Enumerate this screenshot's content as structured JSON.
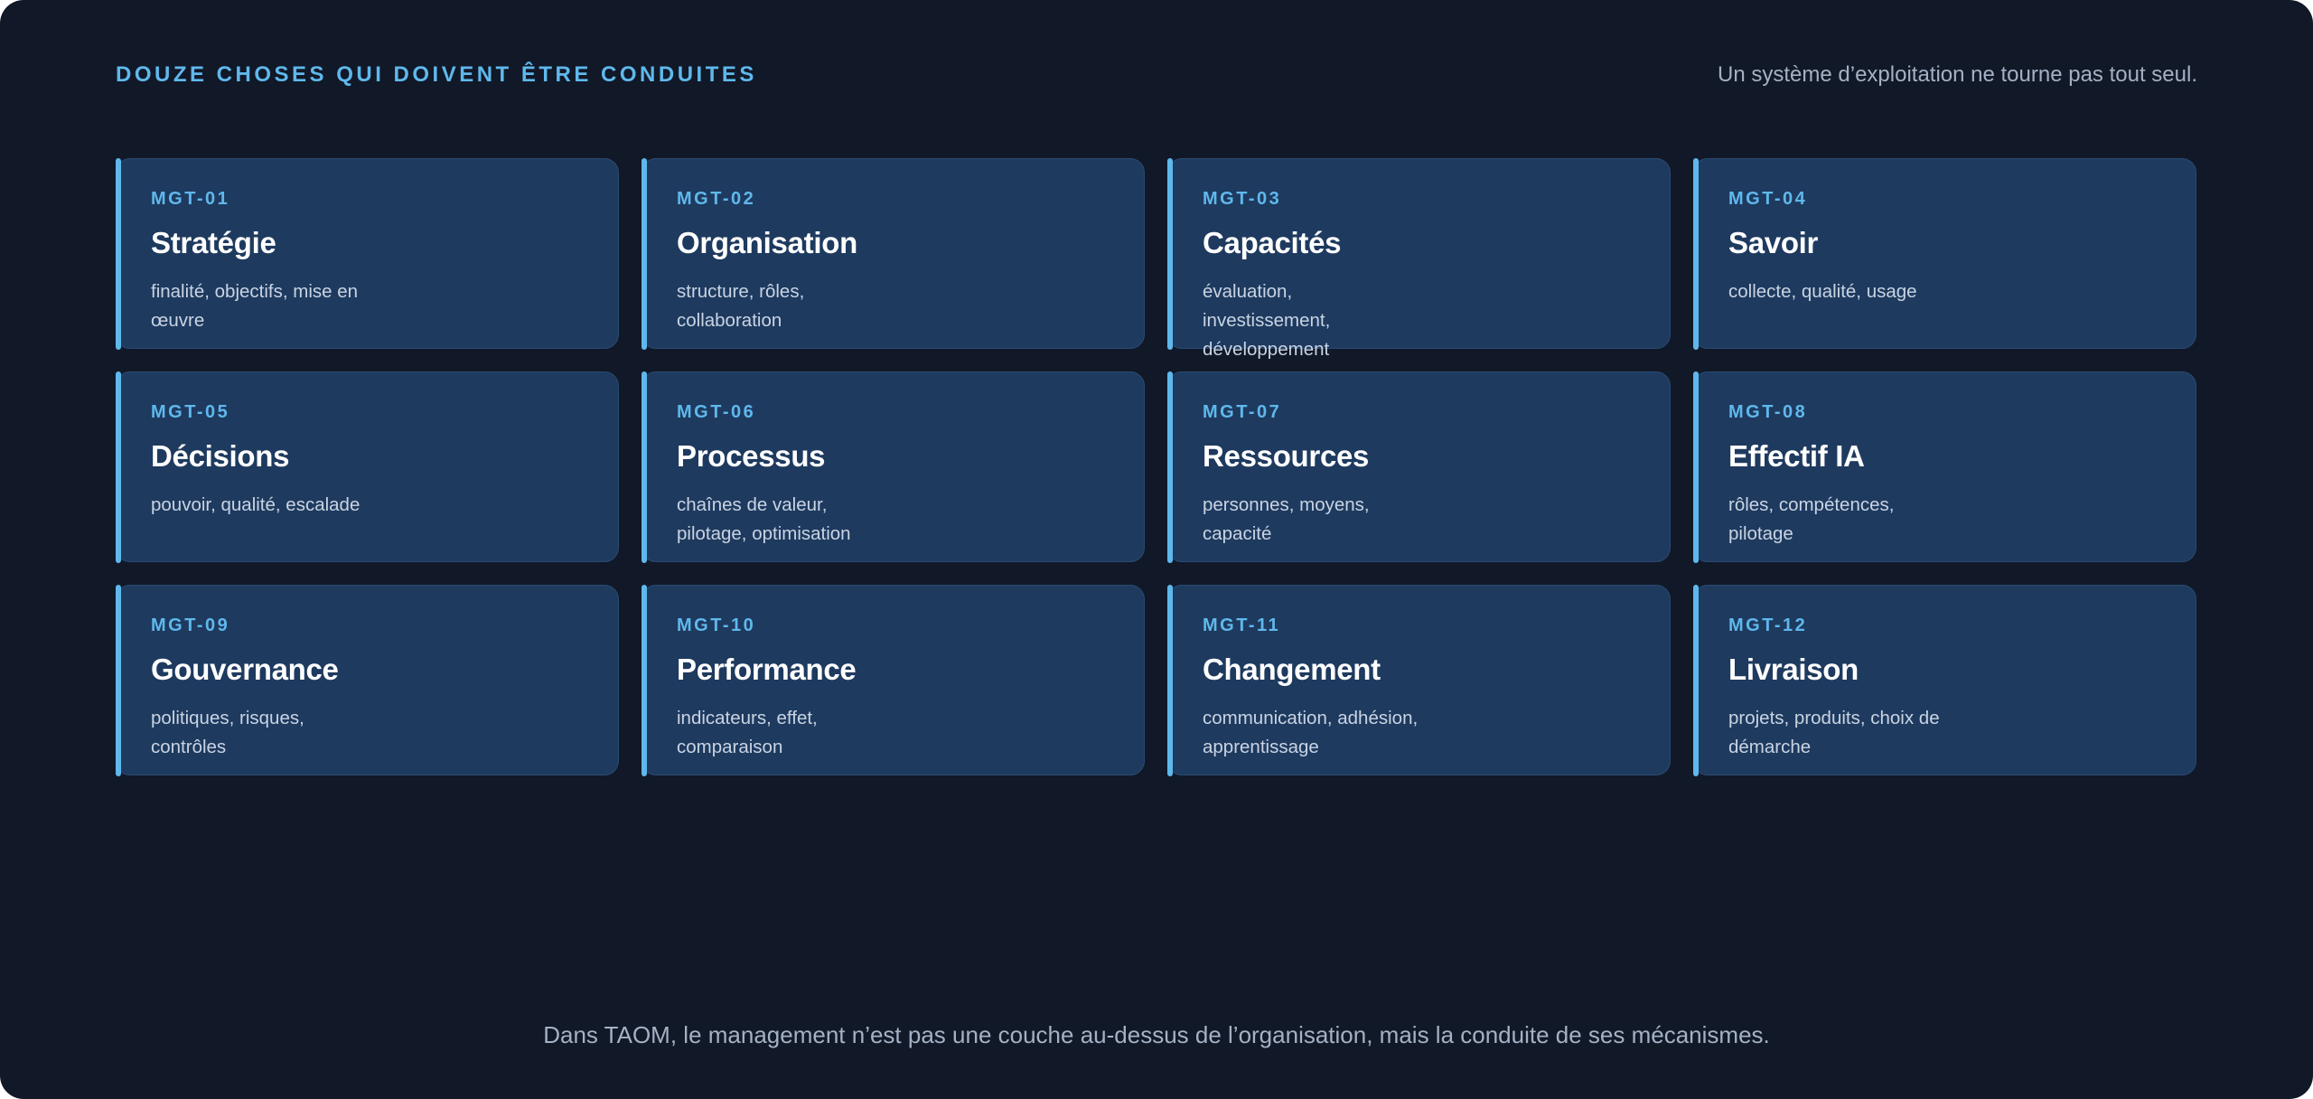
{
  "header": {
    "title": "DOUZE CHOSES QUI DOIVENT ÊTRE CONDUITES",
    "tagline": "Un système d’exploitation ne tourne pas tout seul."
  },
  "cards": [
    {
      "code": "MGT-01",
      "title": "Stratégie",
      "desc": "finalité, objectifs, mise en œuvre"
    },
    {
      "code": "MGT-02",
      "title": "Organisation",
      "desc": "structure, rôles, collaboration"
    },
    {
      "code": "MGT-03",
      "title": "Capacités",
      "desc": "évaluation, investissement, développement"
    },
    {
      "code": "MGT-04",
      "title": "Savoir",
      "desc": "collecte, qualité, usage"
    },
    {
      "code": "MGT-05",
      "title": "Décisions",
      "desc": "pouvoir, qualité, escalade"
    },
    {
      "code": "MGT-06",
      "title": "Processus",
      "desc": "chaînes de valeur, pilotage, optimisation"
    },
    {
      "code": "MGT-07",
      "title": "Ressources",
      "desc": "personnes, moyens, capacité"
    },
    {
      "code": "MGT-08",
      "title": "Effectif IA",
      "desc": "rôles, compétences, pilotage"
    },
    {
      "code": "MGT-09",
      "title": "Gouvernance",
      "desc": "politiques, risques, contrôles"
    },
    {
      "code": "MGT-10",
      "title": "Performance",
      "desc": "indicateurs, effet, comparaison"
    },
    {
      "code": "MGT-11",
      "title": "Changement",
      "desc": "communication, adhésion, apprentissage"
    },
    {
      "code": "MGT-12",
      "title": "Livraison",
      "desc": "projets, produits, choix de démarche"
    }
  ],
  "footer": {
    "text": "Dans TAOM, le management n’est pas une couche au-dessus de l’organisation, mais la conduite de ses mécanismes."
  },
  "colors": {
    "background": "#111827",
    "card": "#1e3a5f",
    "accent": "#5fb8ec"
  }
}
